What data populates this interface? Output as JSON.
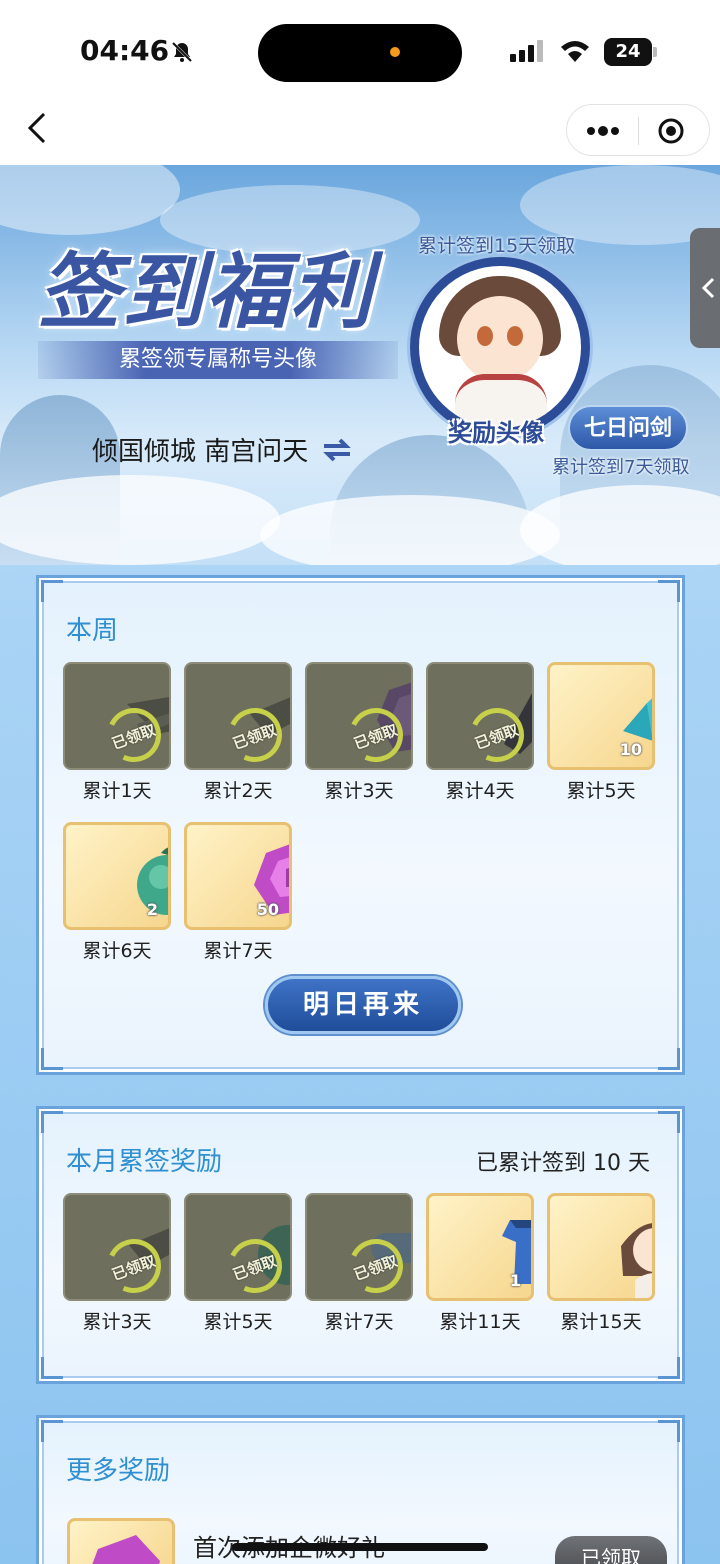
{
  "status_bar": {
    "time": "04:46",
    "battery": "24"
  },
  "banner": {
    "title": "签到福利",
    "subtitle": "累签领专属称号头像",
    "title_name": "倾国倾城 南宫问天",
    "label_15_days": "累计签到15天领取",
    "reward_avatar_label": "奖励头像",
    "title_badge": "七日问剑",
    "label_7_days": "累计签到7天领取"
  },
  "weekly": {
    "heading": "本周",
    "items": [
      {
        "label": "累计1天",
        "status": "已领取",
        "qty": ""
      },
      {
        "label": "累计2天",
        "status": "已领取",
        "qty": ""
      },
      {
        "label": "累计3天",
        "status": "已领取",
        "qty": ""
      },
      {
        "label": "累计4天",
        "status": "已领取",
        "qty": ""
      },
      {
        "label": "累计5天",
        "status": "",
        "qty": "10"
      },
      {
        "label": "累计6天",
        "status": "",
        "qty": "2"
      },
      {
        "label": "累计7天",
        "status": "",
        "qty": "50"
      }
    ],
    "button": "明日再来"
  },
  "monthly": {
    "heading": "本月累签奖励",
    "summary": "已累计签到 10 天",
    "items": [
      {
        "label": "累计3天",
        "status": "已领取",
        "qty": ""
      },
      {
        "label": "累计5天",
        "status": "已领取",
        "qty": ""
      },
      {
        "label": "累计7天",
        "status": "已领取",
        "qty": ""
      },
      {
        "label": "累计11天",
        "status": "",
        "qty": "1"
      },
      {
        "label": "累计15天",
        "status": "",
        "qty": ""
      }
    ]
  },
  "more": {
    "heading": "更多奖励",
    "first_item_text": "首次添加企微好礼",
    "first_item_button": "已领取"
  },
  "colors": {
    "accent": "#2f8fd0",
    "button": "#1f4d9a",
    "claimed_bg": "#6e6f5c",
    "gold_border": "#e8c071"
  }
}
